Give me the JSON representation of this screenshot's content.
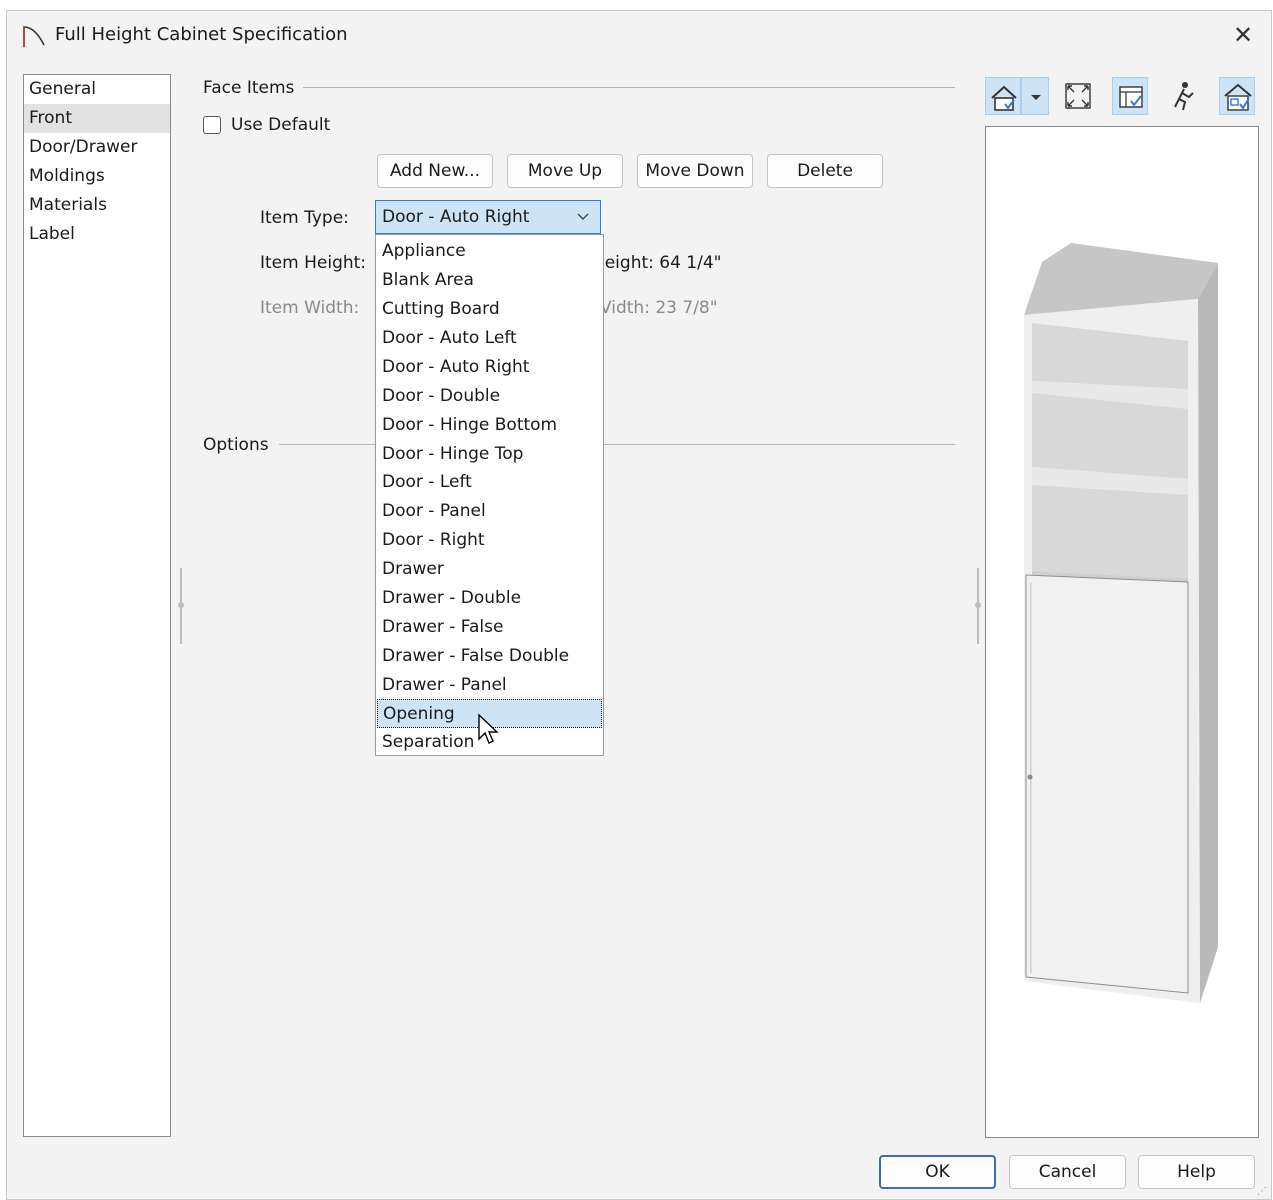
{
  "window": {
    "title": "Full Height Cabinet Specification",
    "close_icon": "close-icon"
  },
  "nav": {
    "items": [
      {
        "label": "General",
        "selected": false
      },
      {
        "label": "Front",
        "selected": true
      },
      {
        "label": "Door/Drawer",
        "selected": false
      },
      {
        "label": "Moldings",
        "selected": false
      },
      {
        "label": "Materials",
        "selected": false
      },
      {
        "label": "Label",
        "selected": false
      }
    ]
  },
  "face_items": {
    "section_title": "Face Items",
    "use_default_label": "Use Default",
    "use_default_checked": false,
    "buttons": {
      "add_new": "Add New...",
      "move_up": "Move Up",
      "move_down": "Move Down",
      "delete": "Delete"
    },
    "item_type_label": "Item Type:",
    "item_type_value": "Door - Auto Right",
    "item_height_label": "Item Height:",
    "item_width_label": "Item Width:",
    "height_readout": "leight:  64 1/4\"",
    "width_readout": "Vidth:  23 7/8\""
  },
  "dropdown": {
    "items": [
      "Appliance",
      "Blank Area",
      "Cutting Board",
      "Door - Auto Left",
      "Door - Auto Right",
      "Door - Double",
      "Door - Hinge Bottom",
      "Door - Hinge Top",
      "Door - Left",
      "Door - Panel",
      "Door - Right",
      "Drawer",
      "Drawer - Double",
      "Drawer - False",
      "Drawer - False Double",
      "Drawer - Panel",
      "Opening",
      "Separation"
    ],
    "highlighted": "Opening"
  },
  "options": {
    "section_title": "Options"
  },
  "toolbar": {
    "icons": [
      "camera-view-icon",
      "dropdown-arrow-icon",
      "fill-window-icon",
      "toggle-layers-icon",
      "walkthrough-icon",
      "toggle-3d-icon"
    ]
  },
  "footer": {
    "ok": "OK",
    "cancel": "Cancel",
    "help": "Help"
  },
  "colors": {
    "accent": "#2f7bd6",
    "selection": "#cde4f7",
    "dialog_bg": "#f3f3f3"
  }
}
